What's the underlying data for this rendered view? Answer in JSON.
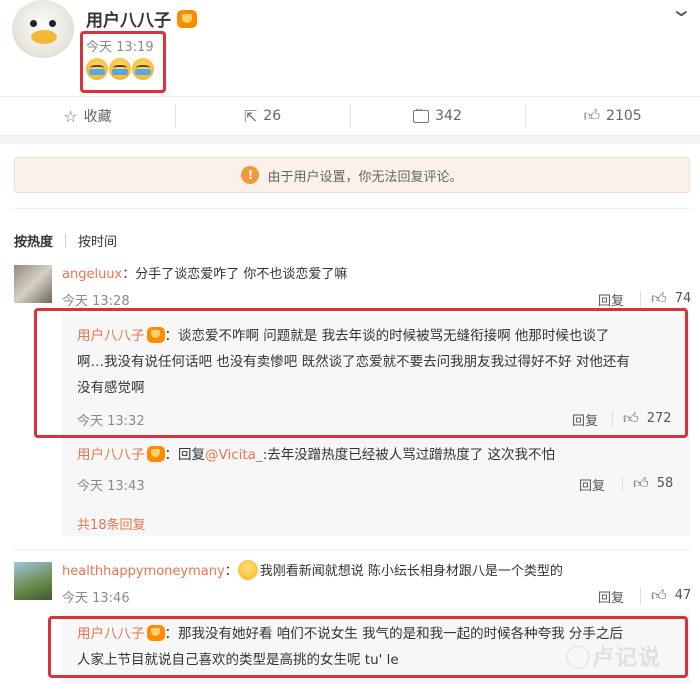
{
  "post": {
    "username": "用户八八子",
    "time": "今天 13:19",
    "emojis": [
      "crying-emoji",
      "crying-emoji",
      "crying-emoji"
    ]
  },
  "actions": {
    "favorite_label": "收藏",
    "share_count": "26",
    "comment_count": "342",
    "like_count": "2105"
  },
  "notice": {
    "text": "由于用户设置，你无法回复评论。"
  },
  "sort": {
    "by_hot": "按热度",
    "by_time": "按时间"
  },
  "comments": [
    {
      "name": "angeluux",
      "text": "：分手了谈恋爱咋了 你不也谈恋爱了嘛",
      "time": "今天 13:28",
      "reply_label": "回复",
      "likes": "74",
      "replies": [
        {
          "name": "用户八八子",
          "text_line1": "：谈恋爱不咋啊 问题就是 我去年谈的时候被骂无缝衔接啊 他那时候也谈了",
          "text_line2": "啊…我没有说任何话吧 也没有卖惨吧  既然谈了恋爱就不要去问我朋友我过得好不好 对他还有",
          "text_line3": "没有感觉啊",
          "time": "今天 13:32",
          "reply_label": "回复",
          "likes": "272"
        },
        {
          "name": "用户八八子",
          "text_prefix": "：回复",
          "mention": "@Vicita_",
          "text": ":去年没蹭热度已经被人骂过蹭热度了 这次我不怕",
          "time": "今天 13:43",
          "reply_label": "回复",
          "likes": "58"
        }
      ],
      "more_replies": "共18条回复"
    },
    {
      "name": "healthhappymoneymany",
      "text": "我刚看新闻就想说 陈小纭长相身材跟八是一个类型的",
      "time": "今天 13:46",
      "reply_label": "回复",
      "likes": "47",
      "replies": [
        {
          "name": "用户八八子",
          "text_line1": "：那我没有她好看 咱们不说女生 我气的是和我一起的时候各种夸我 分手之后",
          "text_line2": "人家上节目就说自己喜欢的类型是高挑的女生呢  tu' le"
        }
      ]
    }
  ],
  "watermark": "卢记说",
  "colors": {
    "accent_orange": "#eb7350",
    "highlight_red": "#d9323d",
    "notice_bg": "#fbf1e8"
  }
}
